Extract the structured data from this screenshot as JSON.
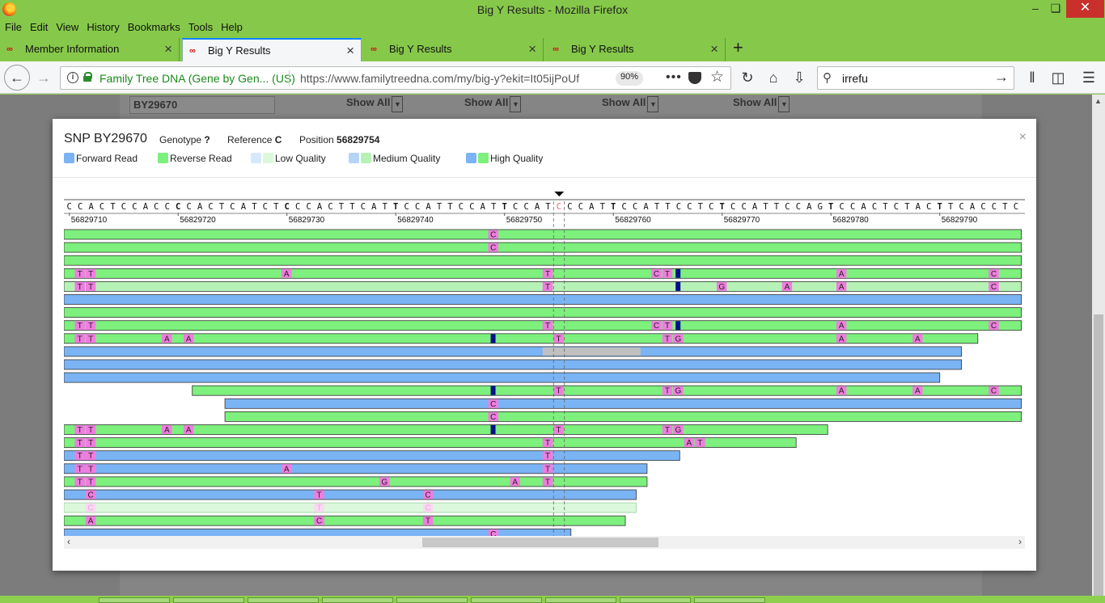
{
  "window": {
    "title": "Big Y Results - Mozilla Firefox"
  },
  "menu": [
    "File",
    "Edit",
    "View",
    "History",
    "Bookmarks",
    "Tools",
    "Help"
  ],
  "tabs": [
    {
      "label": "Member Information",
      "active": false
    },
    {
      "label": "Big Y Results",
      "active": true
    },
    {
      "label": "Big Y Results",
      "active": false
    },
    {
      "label": "Big Y Results",
      "active": false
    }
  ],
  "urlbar": {
    "identity": "Family Tree DNA (Gene by Gen... (US)",
    "url": "https://www.familytreedna.com/my/big-y?ekit=It05ijPoUf",
    "zoom": "90%"
  },
  "search": {
    "value": "irrefu"
  },
  "background": {
    "field": "BY29670",
    "selects": [
      "Show All",
      "Show All",
      "Show All",
      "Show All"
    ]
  },
  "modal": {
    "title": "SNP BY29670",
    "genotype_label": "Genotype",
    "genotype": "?",
    "reference_label": "Reference",
    "reference": "C",
    "position_label": "Position",
    "position": "56829754",
    "close": "×",
    "legend": [
      "Forward Read",
      "Reverse Read",
      "Low Quality",
      "Medium Quality",
      "High Quality"
    ]
  },
  "colors": {
    "forward": "#7ab4f5",
    "reverse": "#7df07d",
    "forward_low": "#d6e8fb",
    "reverse_low": "#dcf8dc",
    "forward_med": "#b4d4f8",
    "reverse_med": "#b6f2b6",
    "mismatch": "#f07de0",
    "deletion": "#000e8a",
    "marker": "#e07070"
  },
  "viewer": {
    "reference_sequence": "CCACTCCACCCCACTCATCTCCCACTTCATTCCATTCCATTCCATCCCATTCCATTCCTCTCCATTCCAGTCCACTCTACTTCACCTCAC",
    "bold_positions": [
      10,
      20,
      30,
      40,
      50,
      60,
      70,
      80
    ],
    "seq_start": 56829709,
    "ruler_start": 56829710,
    "ruler_step": 10,
    "ruler_labels": [
      "56829710",
      "56829720",
      "56829730",
      "56829740",
      "56829750",
      "56829760",
      "56829770",
      "56829780",
      "56829790"
    ],
    "snp_index": 45,
    "reads": [
      {
        "s": 0,
        "e": 88,
        "t": "r",
        "m": [
          [
            39,
            "C"
          ]
        ]
      },
      {
        "s": 0,
        "e": 88,
        "t": "r",
        "m": [
          [
            39,
            "C"
          ]
        ]
      },
      {
        "s": 0,
        "e": 88,
        "t": "r",
        "m": []
      },
      {
        "s": 0,
        "e": 88,
        "t": "r",
        "m": [
          [
            1,
            "T"
          ],
          [
            2,
            "T"
          ],
          [
            20,
            "A"
          ],
          [
            44,
            "T"
          ],
          [
            54,
            "C"
          ],
          [
            55,
            "T"
          ],
          [
            56,
            "#"
          ],
          [
            71,
            "A"
          ],
          [
            85,
            "C"
          ]
        ]
      },
      {
        "s": 0,
        "e": 88,
        "t": "r",
        "q": "m",
        "m": [
          [
            1,
            "T"
          ],
          [
            2,
            "T"
          ],
          [
            44,
            "T"
          ],
          [
            56,
            "#"
          ],
          [
            60,
            "G"
          ],
          [
            66,
            "A"
          ],
          [
            71,
            "A"
          ],
          [
            85,
            "C"
          ]
        ]
      },
      {
        "s": 0,
        "e": 88,
        "t": "f",
        "m": []
      },
      {
        "s": 0,
        "e": 88,
        "t": "r",
        "m": []
      },
      {
        "s": 0,
        "e": 88,
        "t": "r",
        "m": [
          [
            1,
            "T"
          ],
          [
            2,
            "T"
          ],
          [
            44,
            "T"
          ],
          [
            54,
            "C"
          ],
          [
            55,
            "T"
          ],
          [
            56,
            "#"
          ],
          [
            71,
            "A"
          ],
          [
            85,
            "C"
          ]
        ]
      },
      {
        "s": 0,
        "e": 84,
        "t": "r",
        "m": [
          [
            1,
            "T"
          ],
          [
            2,
            "T"
          ],
          [
            9,
            "A"
          ],
          [
            11,
            "A"
          ],
          [
            39,
            "#"
          ],
          [
            45,
            "T"
          ],
          [
            55,
            "T"
          ],
          [
            56,
            "G"
          ],
          [
            71,
            "A"
          ],
          [
            78,
            "A"
          ]
        ]
      },
      {
        "s": 0,
        "e": 82.5,
        "t": "f",
        "m": [],
        "gap": [
          44,
          53
        ]
      },
      {
        "s": 0,
        "e": 82.5,
        "t": "f",
        "m": []
      },
      {
        "s": 0,
        "e": 80.5,
        "t": "f",
        "m": []
      },
      {
        "s": 11.8,
        "e": 88,
        "t": "r",
        "m": [
          [
            39,
            "#"
          ],
          [
            45,
            "T"
          ],
          [
            55,
            "T"
          ],
          [
            56,
            "G"
          ],
          [
            71,
            "A"
          ],
          [
            78,
            "A"
          ],
          [
            85,
            "C"
          ]
        ]
      },
      {
        "s": 14.8,
        "e": 88,
        "t": "f",
        "m": [
          [
            39,
            "C"
          ]
        ]
      },
      {
        "s": 14.8,
        "e": 88,
        "t": "r",
        "m": [
          [
            39,
            "C"
          ]
        ]
      },
      {
        "s": 0,
        "e": 70.2,
        "t": "r",
        "m": [
          [
            1,
            "T"
          ],
          [
            2,
            "T"
          ],
          [
            9,
            "A"
          ],
          [
            11,
            "A"
          ],
          [
            39,
            "#"
          ],
          [
            45,
            "T"
          ],
          [
            55,
            "T"
          ],
          [
            56,
            "G"
          ]
        ]
      },
      {
        "s": 0,
        "e": 67.3,
        "t": "r",
        "m": [
          [
            1,
            "T"
          ],
          [
            2,
            "T"
          ],
          [
            44,
            "T"
          ],
          [
            57,
            "A"
          ],
          [
            58,
            "T"
          ]
        ]
      },
      {
        "s": 0,
        "e": 56.6,
        "t": "f",
        "m": [
          [
            1,
            "T"
          ],
          [
            2,
            "T"
          ],
          [
            44,
            "T"
          ]
        ]
      },
      {
        "s": 0,
        "e": 53.6,
        "t": "f",
        "m": [
          [
            1,
            "T"
          ],
          [
            2,
            "T"
          ],
          [
            20,
            "A"
          ],
          [
            44,
            "T"
          ]
        ]
      },
      {
        "s": 0,
        "e": 53.6,
        "t": "r",
        "m": [
          [
            1,
            "T"
          ],
          [
            2,
            "T"
          ],
          [
            29,
            "G"
          ],
          [
            41,
            "A"
          ],
          [
            44,
            "T"
          ]
        ]
      },
      {
        "s": 0,
        "e": 52.6,
        "t": "f",
        "m": [
          [
            2,
            "C"
          ],
          [
            23,
            "T"
          ],
          [
            33,
            "C"
          ]
        ]
      },
      {
        "s": 0,
        "e": 52.6,
        "t": "r",
        "q": "l",
        "m": [
          [
            2,
            "C"
          ],
          [
            23,
            "T"
          ],
          [
            33,
            "C"
          ]
        ]
      },
      {
        "s": 0,
        "e": 51.6,
        "t": "r",
        "m": [
          [
            2,
            "A"
          ],
          [
            23,
            "C"
          ],
          [
            33,
            "T"
          ]
        ]
      },
      {
        "s": 0,
        "e": 46.6,
        "t": "f",
        "m": [
          [
            39,
            "C"
          ]
        ]
      }
    ]
  }
}
